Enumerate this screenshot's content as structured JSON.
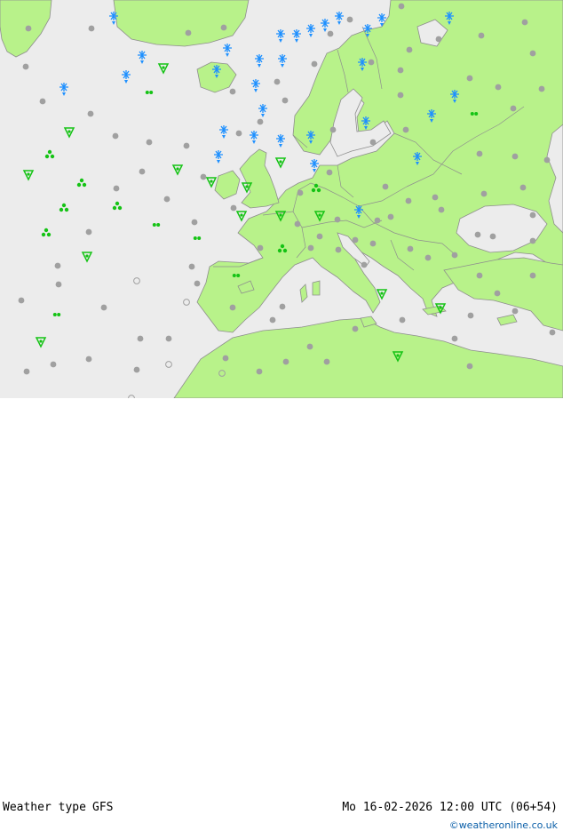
{
  "footer": {
    "product": "Weather type",
    "model": "GFS",
    "datetime": "Mo 16-02-2026 12:00 UTC (06+54)",
    "credit": "©weatheronline.co.uk"
  },
  "colors": {
    "sea": "#ececec",
    "land": "#b8f28a",
    "border": "#8e8e8e",
    "rain_symbol": "#15c315",
    "snow_symbol": "#1e90ff",
    "cloud_symbol": "#a0a0a0"
  },
  "map_symbols": {
    "snow_icon": "snowflake-icon",
    "rain_icon": "rain-shower-icon",
    "cloud_icon": "overcast-dot-icon",
    "clear_icon": "clear-circle-icon"
  }
}
